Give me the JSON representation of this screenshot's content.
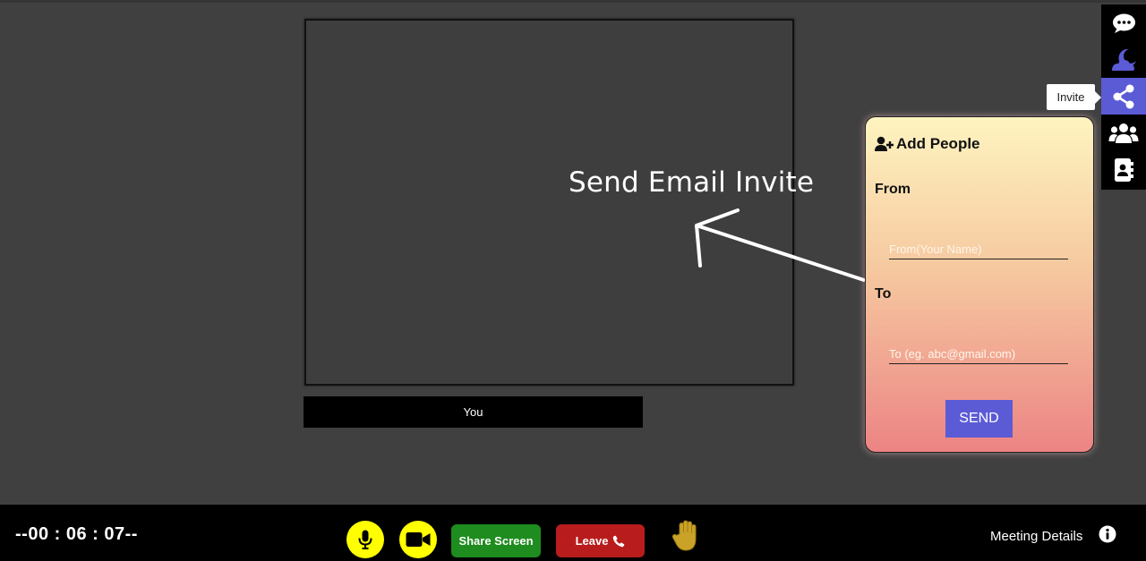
{
  "stage": {
    "self_label": "You"
  },
  "annotation": {
    "text": "Send Email Invite"
  },
  "rail": {
    "items": [
      {
        "name": "chat-icon"
      },
      {
        "name": "moon-icon"
      },
      {
        "name": "share-icon",
        "active": true
      },
      {
        "name": "participants-icon"
      },
      {
        "name": "contacts-icon"
      }
    ],
    "tooltip": "Invite"
  },
  "invite": {
    "title": "Add People",
    "from_label": "From",
    "from_placeholder": "From(Your Name)",
    "to_label": "To",
    "to_placeholder": "To (eg. abc@gmail.com)",
    "send_label": "SEND"
  },
  "bottom": {
    "timer": "--00 : 06 : 07--",
    "share_label": "Share Screen",
    "leave_label": "Leave",
    "meeting_details": "Meeting Details"
  },
  "colors": {
    "accent": "#5b5bd6",
    "mic_camera": "#ffff00",
    "share": "#1e8c1e",
    "leave": "#b81c1c"
  }
}
